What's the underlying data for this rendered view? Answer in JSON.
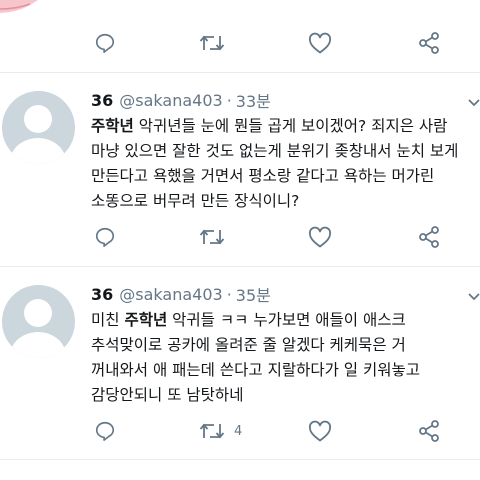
{
  "tweets": [
    {
      "name": "36",
      "handle": "@sakana403",
      "time": "33분",
      "lines": [
        {
          "bold": "주학년",
          "rest": " 악귀년들 눈에 뭔들 곱게 보이겠어? 죄지은 사람"
        },
        {
          "bold": "",
          "rest": "마냥 있으면 잘한 것도 없는게 분위기 좆창내서 눈치 보게"
        },
        {
          "bold": "",
          "rest": "만든다고 욕했을 거면서 평소랑 같다고 욕하는 머가린"
        },
        {
          "bold": "",
          "rest": "소똥으로 버무려 만든 장식이니?"
        }
      ],
      "retweet_count": ""
    },
    {
      "name": "36",
      "handle": "@sakana403",
      "time": "35분",
      "lines": [
        {
          "pre": "미친 ",
          "bold": "주학년",
          "rest": " 악귀들 ㅋㅋ 누가보면 애들이 애스크"
        },
        {
          "pre": "",
          "bold": "",
          "rest": "추석맞이로 공카에 올려준 줄 알겠다 케케묵은 거"
        },
        {
          "pre": "",
          "bold": "",
          "rest": "꺼내와서 애 패는데 쓴다고 지랄하다가 일 키워놓고"
        },
        {
          "pre": "",
          "bold": "",
          "rest": "감당안되니 또 남탓하네"
        }
      ],
      "retweet_count": "4"
    }
  ],
  "colors": {
    "icon": "#657786",
    "divider": "#e6ecf0",
    "avatar_bg": "#ccd6dd"
  },
  "icons": [
    "reply-icon",
    "retweet-icon",
    "like-icon",
    "share-icon",
    "chevron-down-icon"
  ]
}
